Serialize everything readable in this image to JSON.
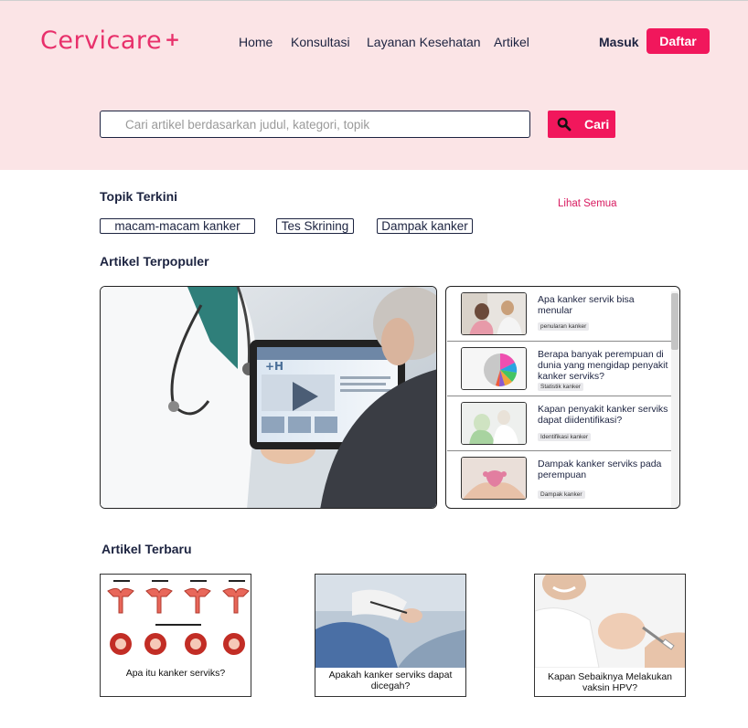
{
  "brand": {
    "name": "Cervicare",
    "suffix": "+",
    "color": "#e8306b"
  },
  "nav": [
    {
      "label": "Home"
    },
    {
      "label": "Konsultasi"
    },
    {
      "label": "Layanan Kesehatan"
    },
    {
      "label": "Artikel"
    }
  ],
  "auth": {
    "login_label": "Masuk",
    "register_label": "Daftar"
  },
  "search": {
    "placeholder": "Cari artikel berdasarkan judul, kategori, topik",
    "button_label": "Cari"
  },
  "topics": {
    "title": "Topik Terkini",
    "see_all": "Lihat Semua",
    "chips": [
      "macam-macam kanker",
      "Tes Skrining",
      "Dampak kanker"
    ]
  },
  "popular": {
    "title": "Artikel Terpopuler",
    "items": [
      {
        "title": "Apa kanker servik bisa menular",
        "tag": "penularan kanker"
      },
      {
        "title": "Berapa banyak perempuan di dunia yang mengidap penyakit kanker serviks?",
        "tag": "Statistik kanker"
      },
      {
        "title": "Kapan penyakit kanker serviks dapat diidentifikasi?",
        "tag": "Identifikasi kanker"
      },
      {
        "title": "Dampak kanker serviks  pada perempuan",
        "tag": "Dampak kanker"
      }
    ]
  },
  "latest": {
    "title": "Artikel Terbaru",
    "cards": [
      {
        "caption": "Apa itu kanker serviks?"
      },
      {
        "caption": "Apakah kanker serviks dapat dicegah?"
      },
      {
        "caption": "Kapan Sebaiknya Melakukan vaksin HPV?"
      }
    ]
  },
  "colors": {
    "accent": "#f1175c",
    "hero_bg": "#fbe4e6",
    "text": "#1c2340"
  },
  "icons": {
    "search_button": "magnifier-icon"
  }
}
